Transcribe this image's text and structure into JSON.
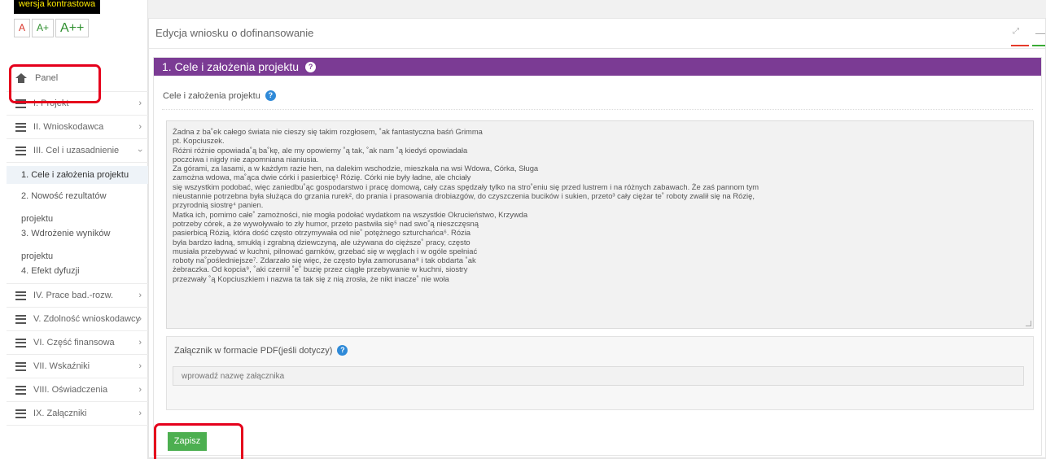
{
  "accessibility": {
    "contrast_label": "wersja kontrastowa",
    "font_small": "A",
    "font_medium": "A+",
    "font_large": "A++"
  },
  "sidebar": {
    "panel_label": "Panel",
    "items": [
      {
        "label": "I. Projekt"
      },
      {
        "label": "II. Wnioskodawca"
      },
      {
        "label": "III. Cel i uzasadnienie"
      }
    ],
    "subitems": [
      {
        "label": "1. Cele i założenia projektu"
      },
      {
        "label": "2. Nowość rezultatów"
      },
      {
        "label": "projektu"
      },
      {
        "label": "3. Wdrożenie wyników"
      },
      {
        "label": "projektu"
      },
      {
        "label": "4. Efekt dyfuzji"
      }
    ],
    "items_after": [
      {
        "label": "IV. Prace bad.-rozw."
      },
      {
        "label": "V. Zdolność wnioskodawcy"
      },
      {
        "label": "VI. Część finansowa"
      },
      {
        "label": "VII. Wskaźniki"
      },
      {
        "label": "VIII. Oświadczenia"
      },
      {
        "label": "IX. Załączniki"
      }
    ]
  },
  "panel": {
    "title": "Edycja wniosku o dofinansowanie"
  },
  "section": {
    "heading": "1. Cele i założenia projektu",
    "field_label": "Cele i założenia projektu",
    "text_lines": [
      "Żadna z ba˚ek całego świata nie cieszy się takim rozgłosem, ˚ak fantastyczna baśń Grimma",
      "pt. Kopciuszek.",
      "Różni różnie opowiada˚ą ba˚kę, ale my opowiemy ˚ą tak, ˚ak nam ˚ą kiedyś opowiadała",
      "poczciwa i nigdy nie zapomniana nianiusia.",
      "Za górami, za lasami, a w każdym razie hen, na dalekim wschodzie, mieszkała na wsi Wdowa, Córka, Sługa",
      "zamożna wdowa, ma˚ąca dwie córki i pasierbicę¹ Rózię. Córki nie były ładne, ale chciały",
      "się wszystkim podobać, więc zaniedbu˚ąc gospodarstwo i pracę domową, cały czas spędzały tylko na stro˚eniu się przed lustrem i na różnych zabawach. Że zaś pannom tym",
      "nieustannie potrzebna była służąca do grzania rurek², do prania i prasowania drobiazgów, do czyszczenia bucików i sukien, przeto³ cały ciężar te˚ roboty zwalił się na Rózię,",
      "przyrodnią siostrę⁴ panien.",
      "Matka ich, pomimo całe˚ zamożności, nie mogła podołać wydatkom na wszystkie Okrucieństwo, Krzywda",
      "potrzeby córek, a że wywoływało to zły humor, przeto pastwiła się⁵ nad swo˚ą nieszczęsną",
      "pasierbicą Rózią, która dość często otrzymywała od nie˚ potężnego szturchańca⁶. Rózia",
      "była bardzo ładną, smukłą i zgrabną dziewczyną, ale używana do cięższe˚ pracy, często",
      "musiała przebywać w kuchni, pilnować garnków, grzebać się w węglach i w ogóle spełniać",
      "roboty na˚pośledniejsze⁷. Zdarzało się więc, że często była zamorusana⁸ i tak obdarta ˚ak",
      "żebraczka. Od kopcia⁹, ˚aki czernił ˚e˚ buzię przez ciągłe przebywanie w kuchni, siostry",
      "przezwały ˚ą Kopciuszkiem i nazwa ta tak się z nią zrosła, że nikt inacze˚ nie woła"
    ],
    "attachment_label": "Załącznik w formacie PDF(jeśli dotyczy)",
    "attachment_placeholder": "wprowadź nazwę załącznika",
    "help_mark": "?"
  },
  "actions": {
    "save_label": "Zapisz"
  },
  "colors": {
    "section_header": "#7b3b94",
    "save_button": "#4caf50",
    "highlight_box": "#e5001c",
    "help_icon": "#2f8ad8"
  },
  "icons": [
    "home-icon",
    "list-icon",
    "chevron-right-icon",
    "chevron-down-icon",
    "question-icon",
    "expand-icon"
  ]
}
